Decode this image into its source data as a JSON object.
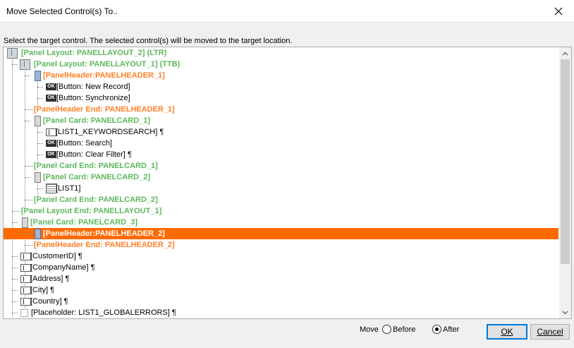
{
  "window": {
    "title": "Move Selected Control(s) To.."
  },
  "instruction": "Select the target control. The selected control(s) will be moved to the target location.",
  "tree": [
    {
      "label": "[Panel Layout: PANELLAYOUT_2] (LTR)",
      "style": "green",
      "icon": "panel-layout-icon",
      "selected": false
    },
    {
      "label": "[Panel Layout: PANELLAYOUT_1] (TTB)",
      "style": "green",
      "icon": "panel-layout-icon",
      "selected": false
    },
    {
      "label": "[PanelHeader:PANELHEADER_1]",
      "style": "orange",
      "icon": "panel-header-icon",
      "selected": false
    },
    {
      "label": "[Button: New Record]",
      "style": "plain",
      "icon": "button-ok-icon",
      "selected": false
    },
    {
      "label": "[Button: Synchronize]",
      "style": "plain",
      "icon": "button-ok-icon",
      "selected": false
    },
    {
      "label": "[PanelHeader End: PANELHEADER_1]",
      "style": "orange",
      "icon": "",
      "selected": false
    },
    {
      "label": "[Panel Card: PANELCARD_1]",
      "style": "green",
      "icon": "panel-card-icon",
      "selected": false
    },
    {
      "label": "[LIST1_KEYWORDSEARCH] ¶",
      "style": "plain",
      "icon": "text-field-icon",
      "selected": false
    },
    {
      "label": "[Button: Search]",
      "style": "plain",
      "icon": "button-ok-icon",
      "selected": false
    },
    {
      "label": "[Button: Clear Filter] ¶",
      "style": "plain",
      "icon": "button-ok-icon",
      "selected": false
    },
    {
      "label": "[Panel Card End: PANELCARD_1]",
      "style": "green",
      "icon": "",
      "selected": false
    },
    {
      "label": "[Panel Card: PANELCARD_2]",
      "style": "green",
      "icon": "panel-card-icon",
      "selected": false
    },
    {
      "label": "[LIST1]",
      "style": "plain",
      "icon": "grid-list-icon",
      "selected": false
    },
    {
      "label": "[Panel Card End: PANELCARD_2]",
      "style": "green",
      "icon": "",
      "selected": false
    },
    {
      "label": "[Panel Layout End: PANELLAYOUT_1]",
      "style": "green",
      "icon": "",
      "selected": false
    },
    {
      "label": "[Panel Card: PANELCARD_3]",
      "style": "green",
      "icon": "panel-card-icon",
      "selected": false
    },
    {
      "label": "[PanelHeader:PANELHEADER_2]",
      "style": "orange",
      "icon": "panel-header-icon",
      "selected": true
    },
    {
      "label": "[PanelHeader End: PANELHEADER_2]",
      "style": "orange",
      "icon": "",
      "selected": false
    },
    {
      "label": "[CustomerID] ¶",
      "style": "plain",
      "icon": "text-field-icon",
      "selected": false
    },
    {
      "label": "[CompanyName] ¶",
      "style": "plain",
      "icon": "text-field-icon",
      "selected": false
    },
    {
      "label": "[Address] ¶",
      "style": "plain",
      "icon": "text-field-icon",
      "selected": false
    },
    {
      "label": "[City] ¶",
      "style": "plain",
      "icon": "text-field-icon",
      "selected": false
    },
    {
      "label": "[Country] ¶",
      "style": "plain",
      "icon": "text-field-icon",
      "selected": false
    },
    {
      "label": "[Placeholder: LIST1_GLOBALERRORS] ¶",
      "style": "plain",
      "icon": "placeholder-icon",
      "selected": false
    }
  ],
  "footer": {
    "move_label": "Move",
    "before_label": "Before",
    "after_label": "After",
    "selected_option": "After",
    "ok_label": "OK",
    "cancel_label": "Cancel"
  },
  "colors": {
    "selection": "#ff6a00",
    "green": "#5cb85c",
    "orange": "#ff7f27"
  }
}
